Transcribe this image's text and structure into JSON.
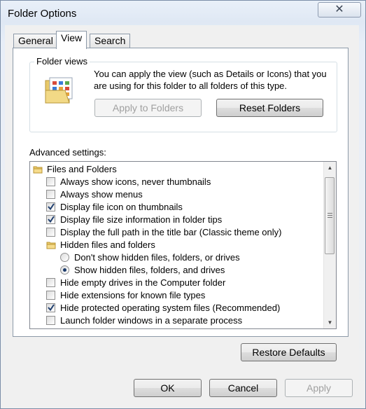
{
  "window": {
    "title": "Folder Options",
    "close_glyph": "✕"
  },
  "tabs": [
    {
      "label": "General",
      "active": false
    },
    {
      "label": "View",
      "active": true
    },
    {
      "label": "Search",
      "active": false
    }
  ],
  "folder_views": {
    "label": "Folder views",
    "description": "You can apply the view (such as Details or Icons) that you are using for this folder to all folders of this type.",
    "apply_button": "Apply to Folders",
    "reset_button": "Reset Folders"
  },
  "advanced": {
    "label": "Advanced settings:",
    "items": [
      {
        "type": "folder",
        "indent": 0,
        "label": "Files and Folders"
      },
      {
        "type": "checkbox",
        "indent": 1,
        "checked": false,
        "label": "Always show icons, never thumbnails"
      },
      {
        "type": "checkbox",
        "indent": 1,
        "checked": false,
        "label": "Always show menus"
      },
      {
        "type": "checkbox",
        "indent": 1,
        "checked": true,
        "label": "Display file icon on thumbnails"
      },
      {
        "type": "checkbox",
        "indent": 1,
        "checked": true,
        "label": "Display file size information in folder tips"
      },
      {
        "type": "checkbox",
        "indent": 1,
        "checked": false,
        "label": "Display the full path in the title bar (Classic theme only)"
      },
      {
        "type": "folder",
        "indent": 1,
        "label": "Hidden files and folders"
      },
      {
        "type": "radio",
        "indent": 2,
        "checked": false,
        "label": "Don't show hidden files, folders, or drives"
      },
      {
        "type": "radio",
        "indent": 2,
        "checked": true,
        "label": "Show hidden files, folders, and drives"
      },
      {
        "type": "checkbox",
        "indent": 1,
        "checked": false,
        "label": "Hide empty drives in the Computer folder"
      },
      {
        "type": "checkbox",
        "indent": 1,
        "checked": false,
        "label": "Hide extensions for known file types"
      },
      {
        "type": "checkbox",
        "indent": 1,
        "checked": true,
        "label": "Hide protected operating system files (Recommended)"
      },
      {
        "type": "checkbox",
        "indent": 1,
        "checked": false,
        "label": "Launch folder windows in a separate process"
      }
    ]
  },
  "restore_button": "Restore Defaults",
  "footer": {
    "ok": "OK",
    "cancel": "Cancel",
    "apply": "Apply"
  }
}
